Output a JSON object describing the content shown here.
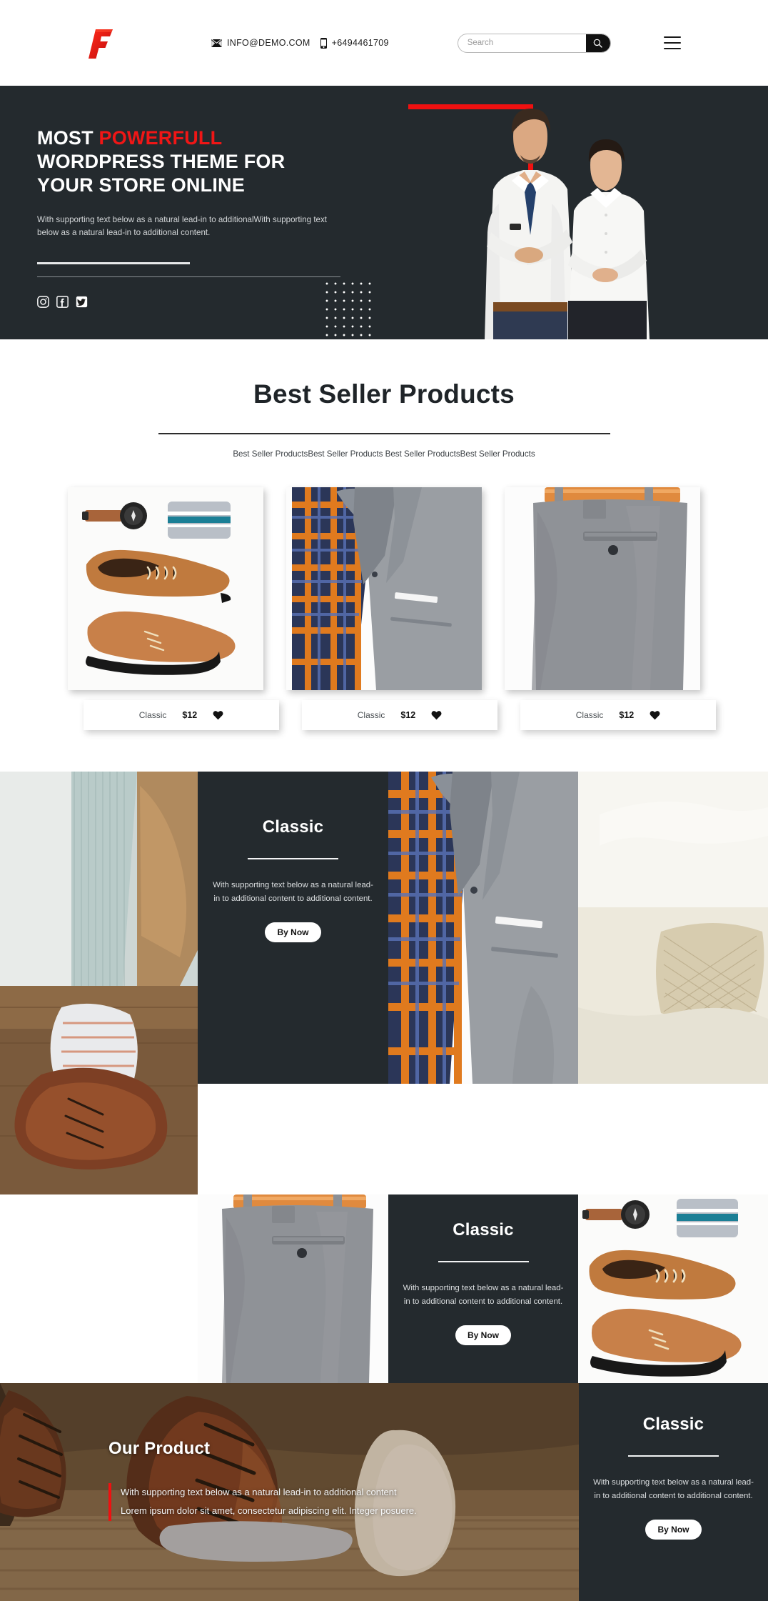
{
  "header": {
    "logo_text": "F",
    "logo_color": "#e01b1b",
    "email_icon": "mail-icon",
    "email": "INFO@DEMO.COM",
    "phone_icon": "phone-icon",
    "phone": "+6494461709",
    "search": {
      "placeholder": "Search",
      "value": "",
      "icon": "search-icon"
    },
    "menu_icon": "hamburger-menu-icon"
  },
  "hero": {
    "title_part1": "MOST ",
    "title_accent": "POWERFULL",
    "title_part2": "WORDPRESS THEME FOR YOUR STORE ONLINE",
    "description": "With supporting text below as a natural lead-in to additionalWith supporting text below as a natural lead-in to additional content.",
    "socials": [
      {
        "name": "instagram-icon",
        "label": "Instagram"
      },
      {
        "name": "facebook-icon",
        "label": "Facebook"
      },
      {
        "name": "twitter-icon",
        "label": "Twitter"
      }
    ],
    "accent_color": "#f01616",
    "background_color": "#242a2e"
  },
  "bestseller": {
    "title": "Best Seller Products",
    "subtitle": "Best Seller ProductsBest Seller Products Best Seller ProductsBest Seller Products",
    "products": [
      {
        "image": "shoes-watch-socks-flatlay",
        "name": "Classic",
        "price": "$12",
        "fav_icon": "heart-icon"
      },
      {
        "image": "grey-blazer-plaid-shirt",
        "name": "Classic",
        "price": "$12",
        "fav_icon": "heart-icon"
      },
      {
        "image": "grey-trousers-tan-belt",
        "name": "Classic",
        "price": "$12",
        "fav_icon": "heart-icon"
      }
    ]
  },
  "grid": {
    "promo_title": "Classic",
    "promo_desc": "With supporting text below as a natural lead-in to additional content to additional content.",
    "buy_label": "By Now",
    "images": [
      "jeans-socks-brown-shoe",
      "grey-blazer-plaid-shirt",
      "white-fabric-texture",
      "grey-trousers-tan-belt",
      "shoes-watch-socks-flatlay"
    ]
  },
  "ourproduct": {
    "title": "Our Product",
    "line1": "With supporting text below as a natural lead-in to additional content",
    "line2": "Lorem ipsum dolor sit amet, consectetur adipiscing elit. Integer posuere.",
    "background_image": "brown-dress-shoes-on-wood",
    "accent_bar_color": "#f01010"
  }
}
